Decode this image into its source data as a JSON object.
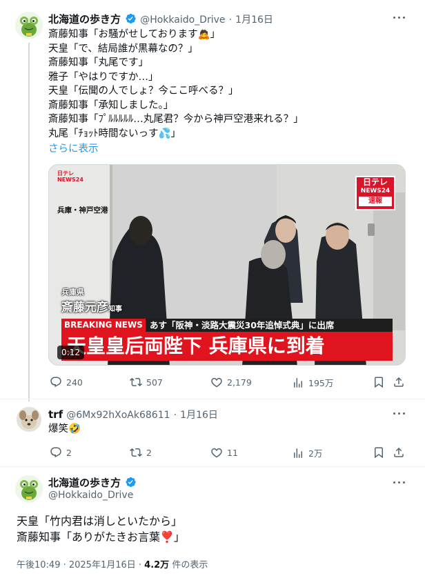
{
  "tweet1": {
    "name": "北海道の歩き方",
    "handle": "@Hokkaido_Drive",
    "separator": "·",
    "date": "1月16日",
    "lines": [
      "斎藤知事「お騒がせしております🙇」",
      "天皇「で、結局誰が黒幕なの？」",
      "斎藤知事「丸尾です」",
      "雅子「やはりですか…」",
      "天皇「伝聞の人でしょ？今ここ呼べる？」",
      "斎藤知事「承知しました。」",
      "斎藤知事「ﾌﾟﾙﾙﾙﾙﾙ…丸尾君？今から神戸空港来れる？」",
      "丸尾「ﾁｮｯﾄ時間ないっす💦」"
    ],
    "show_more": "さらに表示",
    "video": {
      "corner_logo": "日テレ NEWS24",
      "channel_logo_top": "日テレ",
      "channel_logo_mid": "NEWS24",
      "channel_logo_bottom": "速報",
      "location": "兵庫・神戸空港",
      "person_prefecture": "兵庫県",
      "person_name": "斎藤元彦",
      "person_title": "知事",
      "breaking": "BREAKING NEWS",
      "subheadline": "あす「阪神・淡路大震災30年追悼式典」に出席",
      "headline": "天皇皇后両陛下 兵庫県に到着",
      "duration": "0:12"
    },
    "stats": {
      "replies": "240",
      "retweets": "507",
      "likes": "2,179",
      "views": "195万"
    }
  },
  "reply1": {
    "name": "trf",
    "handle": "@6Mx92hXoAk68611",
    "separator": "·",
    "date": "1月16日",
    "text": "爆笑🤣",
    "stats": {
      "replies": "2",
      "retweets": "2",
      "likes": "11",
      "views": "2万"
    }
  },
  "main_tweet": {
    "name": "北海道の歩き方",
    "handle": "@Hokkaido_Drive",
    "lines": [
      "天皇「竹内君は消しといたから」",
      "斎藤知事「ありがたきお言葉❣️」"
    ],
    "time": "午後10:49 · 2025年1月16日 · ",
    "views_count": "4.2万",
    "views_label": " 件の表示"
  },
  "colors": {
    "text": "#0f1419",
    "secondary": "#536471",
    "link": "#1d9bf0",
    "border": "#cfd9de",
    "breaking_red": "#e0141e"
  },
  "icons": [
    "more-icon",
    "reply-icon",
    "retweet-icon",
    "like-icon",
    "views-icon",
    "bookmark-icon",
    "share-icon",
    "verified-icon"
  ]
}
